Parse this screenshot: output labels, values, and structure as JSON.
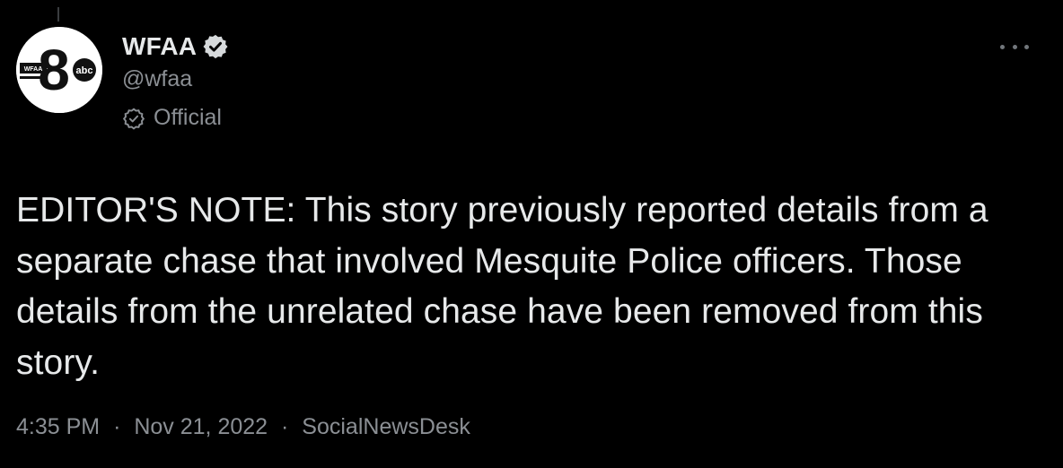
{
  "tweet": {
    "display_name": "WFAA",
    "handle": "@wfaa",
    "label": "Official",
    "text": "EDITOR'S NOTE: This story previously reported details from a separate chase that involved Mesquite Police officers. Those details from the unrelated chase have been removed from this story.",
    "time": "4:35 PM",
    "date": "Nov 21, 2022",
    "source": "SocialNewsDesk",
    "separator": "·",
    "avatar": {
      "logo_text_small": "WFAA",
      "logo_number": "8",
      "logo_network": "abc"
    }
  },
  "colors": {
    "background": "#000000",
    "primary_text": "#e7e9ea",
    "secondary_text": "#8b8f94"
  },
  "icons": {
    "verified": "verified-badge-icon",
    "official": "official-check-icon",
    "more": "more-options-icon"
  }
}
